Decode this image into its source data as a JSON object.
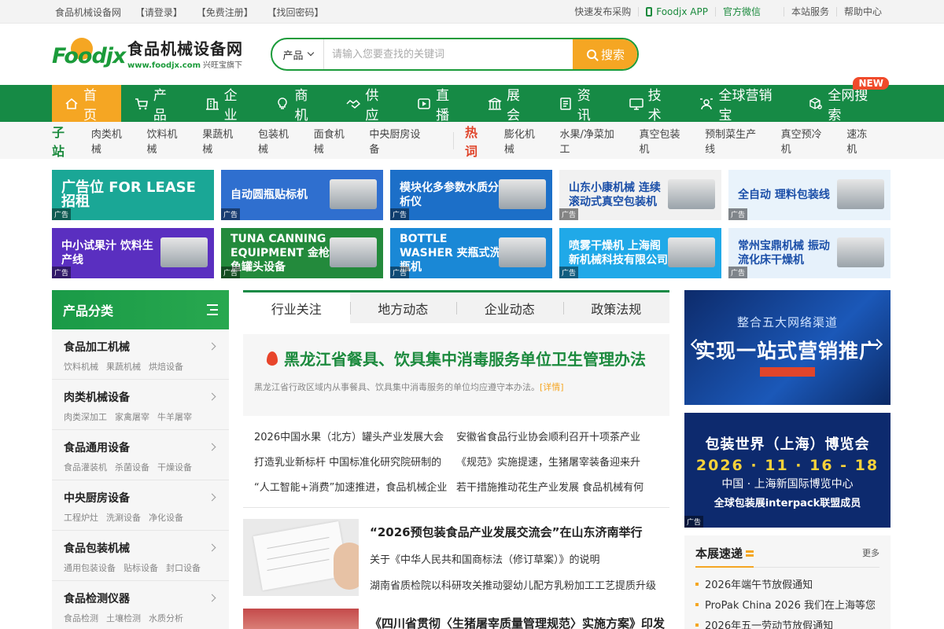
{
  "topbar": {
    "left": [
      "食品机械设备网",
      "【请登录】",
      "【免费注册】",
      "【找回密码】"
    ],
    "right": [
      "快速发布采购",
      "Foodjx APP",
      "官方微信",
      "本站服务",
      "帮助中心"
    ]
  },
  "logo": {
    "mark": "Foodjx",
    "name": "食品机械设备网",
    "url": "www.foodjx.com",
    "tagline": "兴旺宝旗下"
  },
  "search": {
    "category": "产品",
    "placeholder": "请输入您要查找的关键词",
    "button": "搜索"
  },
  "nav": {
    "items": [
      "首页",
      "产品",
      "企业",
      "商机",
      "供应",
      "直播",
      "展会",
      "资讯",
      "技术",
      "全球营销宝",
      "全网搜索"
    ],
    "new_badge": "NEW"
  },
  "subbar": {
    "sub_label": "子站",
    "sub_links": [
      "肉类机械",
      "饮料机械",
      "果蔬机械",
      "包装机械",
      "面食机械",
      "中央厨房设备"
    ],
    "hot_label": "热词",
    "hot_links": [
      "膨化机械",
      "水果/净菜加工",
      "真空包装机",
      "预制菜生产线",
      "真空预冷机",
      "速冻机"
    ]
  },
  "ads": [
    {
      "text": "广告位 FOR LEASE 招租",
      "bg": "#1aa796"
    },
    {
      "text": "自动圆瓶贴标机",
      "bg": "#2f6fcf"
    },
    {
      "text": "模块化多参数水质分析仪",
      "bg": "#1c6fc8"
    },
    {
      "text": "山东小康机械 连续滚动式真空包装机",
      "bg": "#f1f1f1"
    },
    {
      "text": "全自动 理料包装线",
      "bg": "#e9f3fb"
    },
    {
      "text": "中小试果汁 饮料生产线",
      "bg": "#5a2fc0"
    },
    {
      "text": "TUNA CANNING EQUIPMENT 金枪鱼罐头设备",
      "bg": "#238a3c"
    },
    {
      "text": "BOTTLE WASHER 夹瓶式洗瓶机",
      "bg": "#1a88d6"
    },
    {
      "text": "喷雾干燥机 上海阁新机械科技有限公司",
      "bg": "#20a9e8"
    },
    {
      "text": "常州宝鼎机械 振动流化床干燥机",
      "bg": "#e6f1fb"
    }
  ],
  "ad_tag": "广告",
  "categories": {
    "title": "产品分类",
    "items": [
      {
        "name": "食品加工机械",
        "subs": [
          "饮料机械",
          "果蔬机械",
          "烘焙设备"
        ]
      },
      {
        "name": "肉类机械设备",
        "subs": [
          "肉类深加工",
          "家禽屠宰",
          "牛羊屠宰"
        ]
      },
      {
        "name": "食品通用设备",
        "subs": [
          "食品灌装机",
          "杀菌设备",
          "干燥设备"
        ]
      },
      {
        "name": "中央厨房设备",
        "subs": [
          "工程炉灶",
          "洗涮设备",
          "净化设备"
        ]
      },
      {
        "name": "食品包装机械",
        "subs": [
          "通用包装设备",
          "贴标设备",
          "封口设备"
        ]
      },
      {
        "name": "食品检测仪器",
        "subs": [
          "食品检测",
          "土壤检测",
          "水质分析"
        ]
      }
    ]
  },
  "tabs": [
    "行业关注",
    "地方动态",
    "企业动态",
    "政策法规"
  ],
  "headline": {
    "title": "黑龙江省餐具、饮具集中消毒服务单位卫生管理办法",
    "desc": "黑龙江省行政区域内从事餐具、饮具集中消毒服务的单位均应遵守本办法。",
    "more": "[详情]"
  },
  "news": [
    "2026中国水果（北方）罐头产业发展大会",
    "安徽省食品行业协会顺利召开十项茶产业",
    "打造乳业新标杆 中国标准化研究院研制的",
    "《规范》实施提速，生猪屠宰装备迎来升",
    "“人工智能+消费”加速推进，食品机械企业",
    "若干措施推动花生产业发展 食品机械有何"
  ],
  "story": {
    "title": "“2026预包装食品产业发展交流会”在山东济南举行",
    "lines": [
      "关于《中华人民共和国商标法（修订草案）》的说明",
      "湖南省质检院以科研攻关推动婴幼儿配方乳粉加工工艺提质升级"
    ]
  },
  "story2": {
    "title": "《四川省贯彻〈生猪屠宰质量管理规范〉实施方案》印发"
  },
  "banner1": {
    "line1": "整合五大网络渠道",
    "line2": "实现一站式营销推广"
  },
  "banner2": {
    "line1": "包装世界（上海）博览会",
    "line2": "2026 · 11 · 16 - 18",
    "line3": "中国 · 上海新国际博览中心",
    "line4": "全球包装展interpack联盟成员"
  },
  "express": {
    "title": "本展速递",
    "more": "更多",
    "items": [
      "2026年端午节放假通知",
      "ProPak China 2026 我们在上海等您",
      "2026年五一劳动节放假通知"
    ]
  },
  "colors": {
    "brand_green": "#168a45",
    "accent_orange": "#f5a623",
    "hot_red": "#e0452b"
  }
}
